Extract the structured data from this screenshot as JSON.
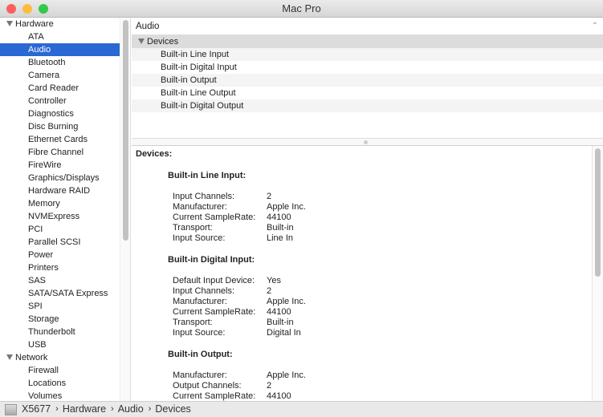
{
  "window": {
    "title": "Mac Pro",
    "controls": {
      "close": "#fc605b",
      "minimize": "#fdbc40",
      "zoom": "#34c84a"
    }
  },
  "sidebar": {
    "items": [
      {
        "label": "Hardware",
        "type": "group"
      },
      {
        "label": "ATA"
      },
      {
        "label": "Audio",
        "selected": true
      },
      {
        "label": "Bluetooth"
      },
      {
        "label": "Camera"
      },
      {
        "label": "Card Reader"
      },
      {
        "label": "Controller"
      },
      {
        "label": "Diagnostics"
      },
      {
        "label": "Disc Burning"
      },
      {
        "label": "Ethernet Cards"
      },
      {
        "label": "Fibre Channel"
      },
      {
        "label": "FireWire"
      },
      {
        "label": "Graphics/Displays"
      },
      {
        "label": "Hardware RAID"
      },
      {
        "label": "Memory"
      },
      {
        "label": "NVMExpress"
      },
      {
        "label": "PCI"
      },
      {
        "label": "Parallel SCSI"
      },
      {
        "label": "Power"
      },
      {
        "label": "Printers"
      },
      {
        "label": "SAS"
      },
      {
        "label": "SATA/SATA Express"
      },
      {
        "label": "SPI"
      },
      {
        "label": "Storage"
      },
      {
        "label": "Thunderbolt"
      },
      {
        "label": "USB"
      },
      {
        "label": "Network",
        "type": "group"
      },
      {
        "label": "Firewall"
      },
      {
        "label": "Locations"
      },
      {
        "label": "Volumes"
      }
    ],
    "selected_color": "#2a68d4"
  },
  "main": {
    "header": "Audio",
    "group": "Devices",
    "rows": [
      "Built-in Line Input",
      "Built-in Digital Input",
      "Built-in Output",
      "Built-in Line Output",
      "Built-in Digital Output"
    ]
  },
  "detail": {
    "title": "Devices:",
    "sections": [
      {
        "name": "Built-in Line Input:",
        "props": [
          [
            "Input Channels:",
            "2"
          ],
          [
            "Manufacturer:",
            "Apple Inc."
          ],
          [
            "Current SampleRate:",
            "44100"
          ],
          [
            "Transport:",
            "Built-in"
          ],
          [
            "Input Source:",
            "Line In"
          ]
        ]
      },
      {
        "name": "Built-in Digital Input:",
        "props": [
          [
            "Default Input Device:",
            "Yes"
          ],
          [
            "Input Channels:",
            "2"
          ],
          [
            "Manufacturer:",
            "Apple Inc."
          ],
          [
            "Current SampleRate:",
            "44100"
          ],
          [
            "Transport:",
            "Built-in"
          ],
          [
            "Input Source:",
            "Digital In"
          ]
        ]
      },
      {
        "name": "Built-in Output:",
        "props": [
          [
            "Manufacturer:",
            "Apple Inc."
          ],
          [
            "Output Channels:",
            "2"
          ],
          [
            "Current SampleRate:",
            "44100"
          ]
        ]
      }
    ]
  },
  "statusbar": {
    "path": [
      "X5677",
      "Hardware",
      "Audio",
      "Devices"
    ]
  }
}
